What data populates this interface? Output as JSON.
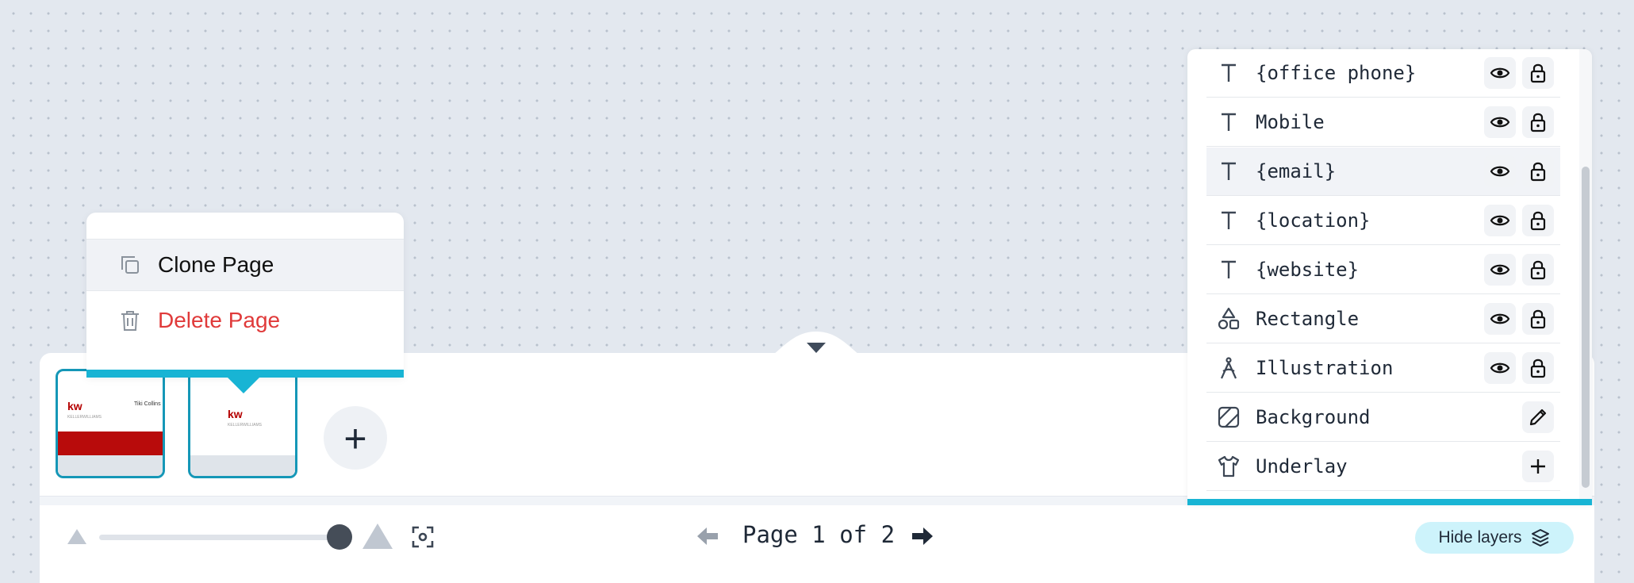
{
  "page_menu": {
    "clone_label": "Clone Page",
    "delete_label": "Delete Page",
    "delete_color": "#e03a3a"
  },
  "thumbnails": [
    {
      "page": 1,
      "logo": "kw",
      "logo_sub": "KELLERWILLIAMS",
      "name_text": "Tiki Collins"
    },
    {
      "page": 2,
      "logo": "kw",
      "logo_sub": "KELLERWILLIAMS"
    }
  ],
  "layers": [
    {
      "icon": "text-icon",
      "name": "{office phone}",
      "controls": [
        "visibility",
        "lock"
      ]
    },
    {
      "icon": "text-icon",
      "name": "Mobile",
      "controls": [
        "visibility",
        "lock"
      ]
    },
    {
      "icon": "text-icon",
      "name": "{email}",
      "controls": [
        "visibility",
        "lock"
      ],
      "active": true
    },
    {
      "icon": "text-icon",
      "name": "{location}",
      "controls": [
        "visibility",
        "lock"
      ]
    },
    {
      "icon": "text-icon",
      "name": "{website}",
      "controls": [
        "visibility",
        "lock"
      ]
    },
    {
      "icon": "shapes-icon",
      "name": "Rectangle",
      "controls": [
        "visibility",
        "lock"
      ]
    },
    {
      "icon": "pen-nib-icon",
      "name": "Illustration",
      "controls": [
        "visibility",
        "lock"
      ]
    },
    {
      "icon": "background-icon",
      "name": "Background",
      "controls": [
        "edit"
      ]
    },
    {
      "icon": "shirt-icon",
      "name": "Underlay",
      "controls": [
        "add"
      ]
    }
  ],
  "footer": {
    "page_indicator": "Page 1 of 2",
    "hide_layers_label": "Hide layers",
    "zoom_value": 1.0
  },
  "colors": {
    "accent": "#18b4d4",
    "thumb_border": "#1597b7",
    "brand_red": "#b40000"
  }
}
